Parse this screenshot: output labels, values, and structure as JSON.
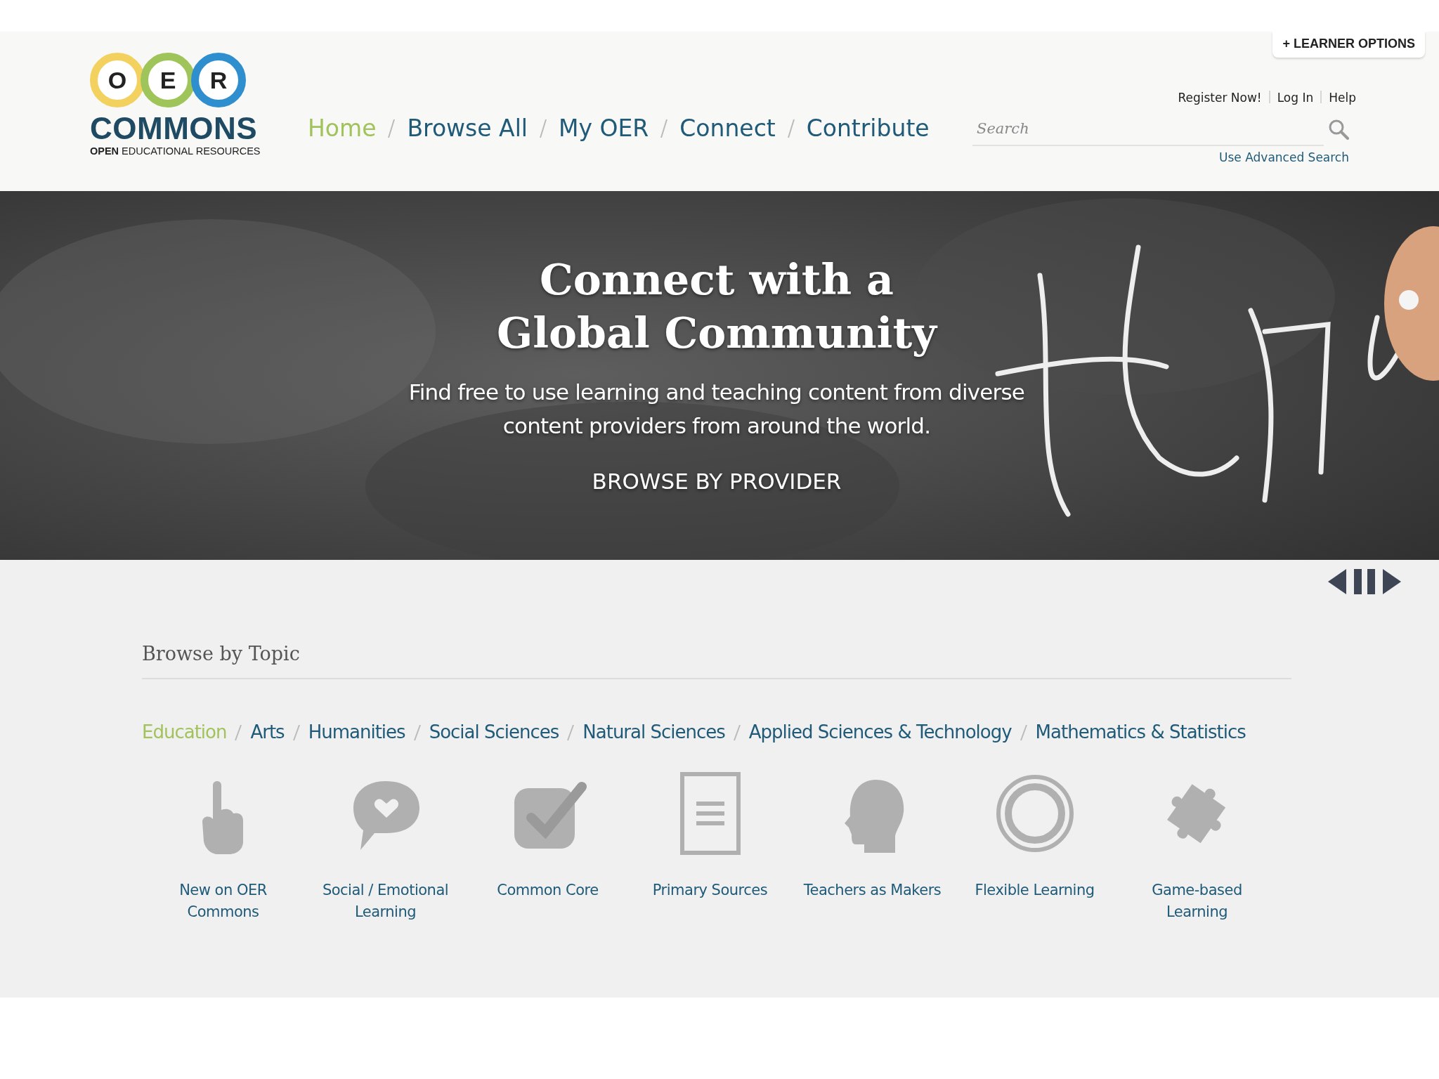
{
  "learner_options": {
    "icon": "+",
    "label": "LEARNER OPTIONS"
  },
  "logo": {
    "letters": [
      "O",
      "E",
      "R"
    ],
    "name": "COMMONS",
    "tagline": "**OPEN** EDUCATIONAL RESOURCES"
  },
  "account_links": [
    "Register Now!",
    "Log In",
    "Help"
  ],
  "nav": [
    {
      "label": "Home",
      "selected": true
    },
    {
      "label": "Browse All",
      "selected": false
    },
    {
      "label": "My OER",
      "selected": false
    },
    {
      "label": "Connect",
      "selected": false
    },
    {
      "label": "Contribute",
      "selected": false
    }
  ],
  "search": {
    "placeholder": "Search",
    "advanced_link": "Use Advanced Search"
  },
  "hero": {
    "kind": "picture",
    "title": [
      "Connect with a",
      "Global Community"
    ],
    "subtitle": [
      "Find free to use learning and teaching content from diverse",
      "content providers from around the world."
    ],
    "link": "BROWSE BY PROVIDER"
  },
  "browse_topics": {
    "heading": "Browse by Topic",
    "subjects": [
      {
        "label": "Education",
        "selected": true
      },
      {
        "label": "Arts",
        "selected": false
      },
      {
        "label": "Humanities",
        "selected": false
      },
      {
        "label": "Social Sciences",
        "selected": false
      },
      {
        "label": "Natural Sciences",
        "selected": false
      },
      {
        "label": "Applied Sciences & Technology",
        "selected": false
      },
      {
        "label": "Mathematics & Statistics",
        "selected": false
      }
    ],
    "tiles": [
      {
        "kind": "hand",
        "label": [
          "New on OER",
          "Commons"
        ]
      },
      {
        "kind": "speech",
        "label": [
          "Social / Emotional",
          "Learning"
        ]
      },
      {
        "kind": "check",
        "label": [
          "Common Core"
        ]
      },
      {
        "kind": "document",
        "label": [
          "Primary Sources"
        ]
      },
      {
        "kind": "head",
        "label": [
          "Teachers as Makers"
        ]
      },
      {
        "kind": "ring",
        "label": [
          "Flexible Learning"
        ]
      },
      {
        "kind": "puzzle",
        "label": [
          "Game-based",
          "Learning"
        ]
      }
    ]
  }
}
